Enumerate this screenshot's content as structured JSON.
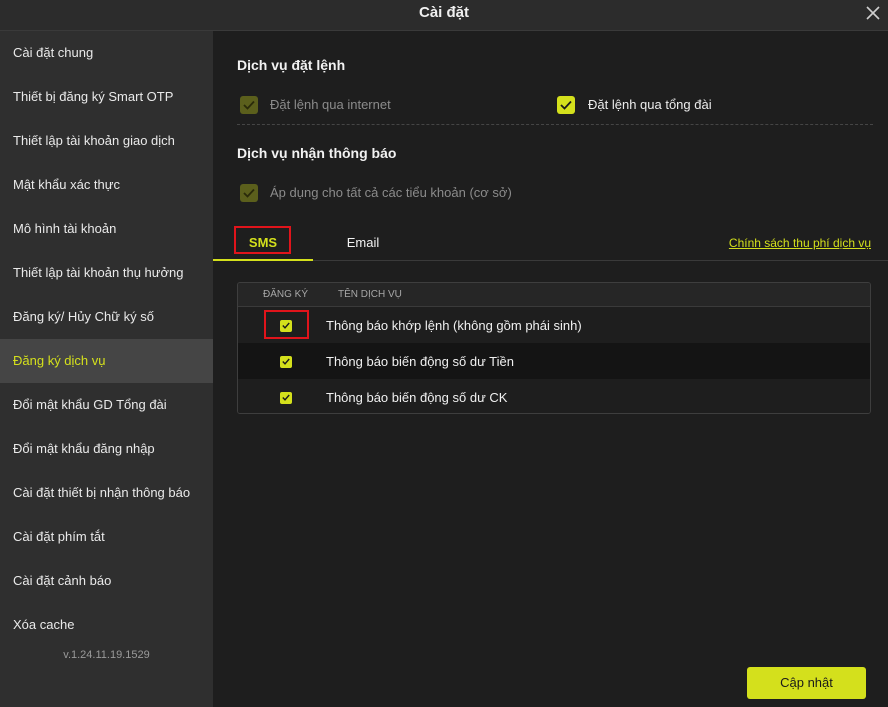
{
  "window": {
    "title": "Cài đặt",
    "close_icon": "close-icon"
  },
  "sidebar": {
    "items": [
      {
        "label": "Cài đặt chung",
        "active": false
      },
      {
        "label": "Thiết bị đăng ký Smart OTP",
        "active": false
      },
      {
        "label": "Thiết lập tài khoản giao dịch",
        "active": false
      },
      {
        "label": "Mật khẩu xác thực",
        "active": false
      },
      {
        "label": "Mô hình tài khoản",
        "active": false
      },
      {
        "label": "Thiết lập tài khoản thụ hưởng",
        "active": false
      },
      {
        "label": "Đăng ký/ Hủy Chữ ký số",
        "active": false
      },
      {
        "label": "Đăng ký dịch vụ",
        "active": true
      },
      {
        "label": "Đổi mật khẩu GD Tổng đài",
        "active": false
      },
      {
        "label": "Đổi mật khẩu đăng nhập",
        "active": false
      },
      {
        "label": "Cài đặt thiết bị nhận thông báo",
        "active": false
      },
      {
        "label": "Cài đặt phím tắt",
        "active": false
      },
      {
        "label": "Cài đặt cảnh báo",
        "active": false
      },
      {
        "label": "Xóa cache",
        "active": false
      }
    ],
    "version": "v.1.24.11.19.1529"
  },
  "order_service": {
    "title": "Dịch vụ đặt lệnh",
    "internet": {
      "label": "Đặt lệnh qua internet",
      "checked": true,
      "disabled": true
    },
    "hotline": {
      "label": "Đặt lệnh qua tổng đài",
      "checked": true,
      "disabled": false
    }
  },
  "notify_service": {
    "title": "Dịch vụ nhận thông báo",
    "apply_all": {
      "label": "Áp dụng cho tất cả các tiểu khoản (cơ sở)",
      "checked": true,
      "disabled": true
    }
  },
  "tabs": [
    {
      "label": "SMS",
      "active": true
    },
    {
      "label": "Email",
      "active": false
    }
  ],
  "policy_link": "Chính sách thu phí dịch vụ",
  "table": {
    "headers": {
      "register": "ĐĂNG KÝ",
      "service_name": "TÊN DỊCH VỤ"
    },
    "rows": [
      {
        "name": "Thông báo khớp lệnh (không gồm phái sinh)",
        "checked": true
      },
      {
        "name": "Thông báo biến động số dư Tiền",
        "checked": true
      },
      {
        "name": "Thông báo biến động số dư CK",
        "checked": true
      }
    ]
  },
  "update_button": "Cập nhật",
  "colors": {
    "accent": "#d4e01c",
    "highlight_box": "#e0141b",
    "background": "#1e1e1e",
    "sidebar": "#2f2f2f"
  }
}
